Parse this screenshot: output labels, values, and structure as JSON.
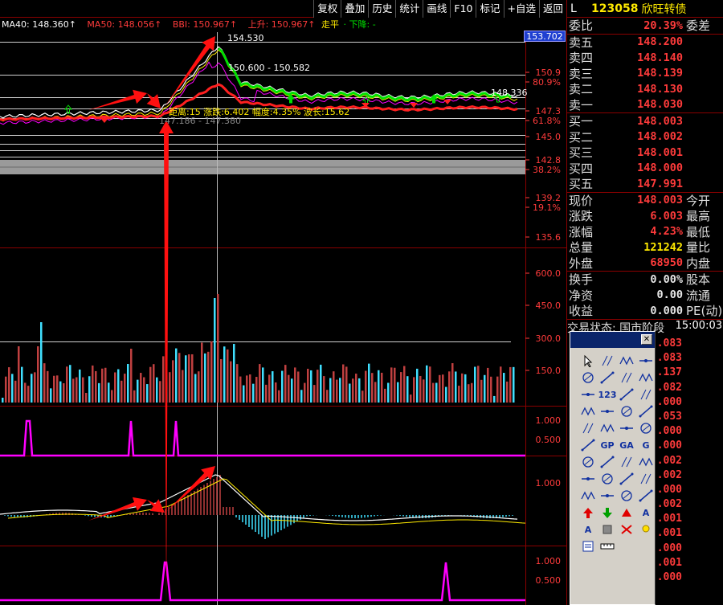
{
  "toolbar": [
    "复权",
    "叠加",
    "历史",
    "统计",
    "画线",
    "F10",
    "标记",
    "+自选",
    "返回"
  ],
  "legend": {
    "ma40": "MA40: 148.360↑",
    "ma50": "MA50: 148.056↑",
    "bbi": "BBI: 150.967↑",
    "up": "上升: 150.967↑",
    "flat": "走平",
    "down": "· 下降: -"
  },
  "price_axis": [
    "153.702",
    "150.9",
    "80.9%",
    "147.3",
    "61.8%",
    "145.0",
    "142.8",
    "38.2%",
    "139.2",
    "19.1%",
    "135.6"
  ],
  "vol_axis": [
    "600.0",
    "450.0",
    "300.0",
    "150.0"
  ],
  "ind1_axis": [
    "1.000",
    "0.500"
  ],
  "ind2_axis": [
    "1.000"
  ],
  "ind3_axis": [
    "1.000",
    "0.500"
  ],
  "annotations": {
    "high": "154.530",
    "range": "150.600 - 150.582",
    "right": "148.336",
    "stat": "距离:15 涨跌:6.402 幅度:4.35% 波长:15.62",
    "low": "147.186 - 147.380"
  },
  "quote": {
    "market": "L",
    "code": "123058",
    "name": "欣旺转债",
    "weibi_label": "委比",
    "weibi": "20.39%",
    "weicha_label": "委差",
    "asks": [
      {
        "label": "卖五",
        "price": "148.200"
      },
      {
        "label": "卖四",
        "price": "148.140"
      },
      {
        "label": "卖三",
        "price": "148.139"
      },
      {
        "label": "卖二",
        "price": "148.130"
      },
      {
        "label": "卖一",
        "price": "148.030"
      }
    ],
    "bids": [
      {
        "label": "买一",
        "price": "148.003"
      },
      {
        "label": "买二",
        "price": "148.002"
      },
      {
        "label": "买三",
        "price": "148.001"
      },
      {
        "label": "买四",
        "price": "148.000"
      },
      {
        "label": "买五",
        "price": "147.991"
      }
    ],
    "stats": [
      {
        "k": "现价",
        "v": "148.003",
        "c": "red",
        "k2": "今开"
      },
      {
        "k": "涨跌",
        "v": "6.003",
        "c": "red",
        "k2": "最高"
      },
      {
        "k": "涨幅",
        "v": "4.23%",
        "c": "red",
        "k2": "最低"
      },
      {
        "k": "总量",
        "v": "121242",
        "c": "yel",
        "k2": "量比"
      },
      {
        "k": "外盘",
        "v": "68950",
        "c": "red",
        "k2": "内盘"
      }
    ],
    "stats2": [
      {
        "k": "换手",
        "v": "0.00%",
        "c": "wht",
        "k2": "股本"
      },
      {
        "k": "净资",
        "v": "0.00",
        "c": "wht",
        "k2": "流通"
      },
      {
        "k": "收益",
        "v": "0.000",
        "c": "wht",
        "k2": "PE(动)"
      }
    ],
    "stage_label": "交易状态: 国市阶段",
    "stage_time": "15:00:03",
    "ticks": [
      ".083",
      ".083",
      ".137",
      ".082",
      ".000",
      ".053",
      ".000",
      ".000",
      ".002",
      ".002",
      ".000",
      ".002",
      ".001",
      ".001",
      ".000",
      ".001",
      ".000"
    ]
  },
  "palette_icons": [
    "pointer-icon",
    "line-segment-icon",
    "ray-icon",
    "arrow-line-icon",
    "trend-line-icon",
    "horizontal-line-icon",
    "horizontal-segment-icon",
    "horizontal-ray-icon",
    "parallel-line-icon",
    "numbered-wave-icon",
    "channel-icon",
    "parallel-channel-icon",
    "curve-icon",
    "arc-icon",
    "circle-icon",
    "target-icon",
    "w-pattern-icon",
    "wave-icon",
    "zigzag-icon",
    "polyline-icon",
    "fan-icon",
    "gp-text-icon",
    "ga-text-icon",
    "gann-icon",
    "period-icon",
    "bars-icon",
    "speed-lines-icon",
    "speed-arc-icon",
    "time-zone-icon",
    "fib-time-icon",
    "cycle-icon",
    "box-icon",
    "resistance-icon",
    "support-icon",
    "fib-fan-icon",
    "rect-icon",
    "up-arrow-icon",
    "down-arrow-icon",
    "mark-icon",
    "text-icon",
    "text-box-icon",
    "stop-icon",
    "delete-icon",
    "light-icon",
    "note-icon",
    "ruler-icon",
    "",
    ""
  ],
  "palette_labels": {
    "9": "123",
    "21": "GP",
    "22": "GA",
    "23": "G",
    "39": "A",
    "40": "A"
  },
  "colors": {
    "red": "#ff3b3b",
    "yellow": "#ffea00",
    "green": "#00e000",
    "cyan": "#40e0ff",
    "magenta": "#ff00ff",
    "frame": "#8a0000"
  }
}
